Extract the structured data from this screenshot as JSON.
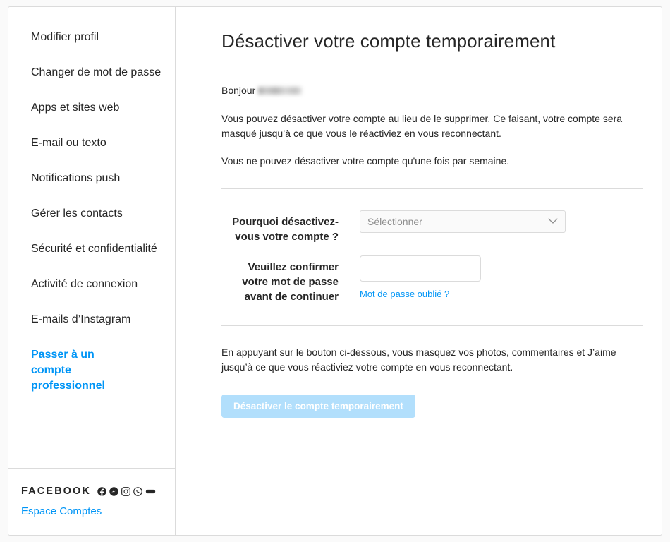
{
  "sidebar": {
    "items": [
      {
        "label": "Modifier profil",
        "type": "nav"
      },
      {
        "label": "Changer de mot de passe",
        "type": "nav"
      },
      {
        "label": "Apps et sites web",
        "type": "nav"
      },
      {
        "label": "E-mail ou texto",
        "type": "nav"
      },
      {
        "label": "Notifications push",
        "type": "nav"
      },
      {
        "label": "Gérer les contacts",
        "type": "nav"
      },
      {
        "label": "Sécurité et confidentialité",
        "type": "nav"
      },
      {
        "label": "Activité de connexion",
        "type": "nav"
      },
      {
        "label": "E-mails d’Instagram",
        "type": "nav"
      },
      {
        "label": "Passer à un compte professionnel",
        "type": "link"
      }
    ],
    "footer": {
      "brand": "FACEBOOK",
      "accounts_link": "Espace Comptes",
      "social_icons": [
        "facebook-icon",
        "messenger-icon",
        "instagram-icon",
        "whatsapp-icon",
        "portal-icon"
      ]
    }
  },
  "main": {
    "title": "Désactiver votre compte temporairement",
    "greeting": "Bonjour",
    "greeting_name_redacted": "",
    "paragraph_1": "Vous pouvez désactiver votre compte au lieu de le supprimer. Ce faisant, votre compte sera masqué jusqu’à ce que vous le réactiviez en vous reconnectant.",
    "paragraph_2": "Vous ne pouvez désactiver votre compte qu'une fois par semaine.",
    "form": {
      "reason_label": "Pourquoi désactivez-vous votre compte ?",
      "reason_value": "Sélectionner",
      "password_label": "Veuillez confirmer votre mot de passe avant de continuer",
      "password_value": "",
      "password_placeholder": "",
      "forgot_password_link": "Mot de passe oublié ?"
    },
    "footer_note": "En appuyant sur le bouton ci-dessous, vous masquez vos photos, commentaires et J’aime jusqu’à ce que vous réactiviez votre compte en vous reconnectant.",
    "deactivate_button": "Désactiver le compte temporairement"
  },
  "colors": {
    "accent_blue": "#0095f6",
    "button_disabled_blue": "#b2dffc",
    "text_primary": "#262626",
    "text_muted": "#8e8e8e",
    "border": "#dbdbdb",
    "page_background": "#fafafa"
  }
}
